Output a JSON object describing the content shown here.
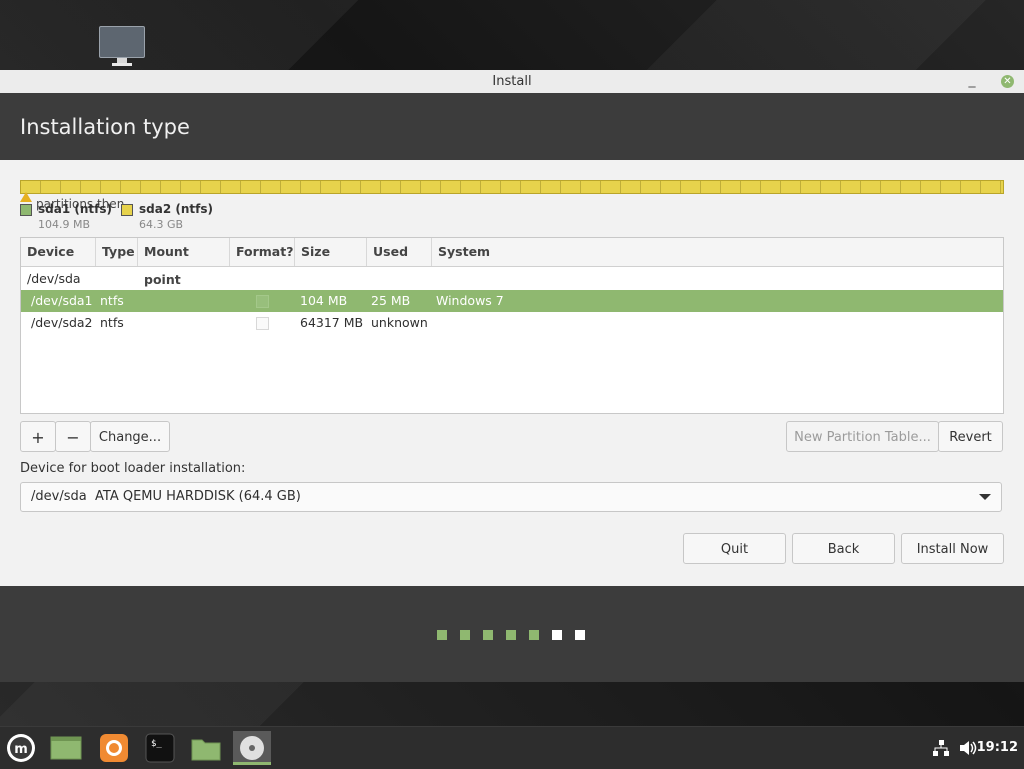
{
  "window": {
    "title": "Install"
  },
  "header": {
    "title": "Installation type"
  },
  "partition_bar": {
    "warning_text": "partitions then",
    "legend": [
      {
        "name": "sda1 (ntfs)",
        "size": "104.9 MB",
        "color": "#8fb870"
      },
      {
        "name": "sda2 (ntfs)",
        "size": "64.3 GB",
        "color": "#e7d34c"
      }
    ]
  },
  "table": {
    "columns": [
      "Device",
      "Type",
      "Mount point",
      "Format?",
      "Size",
      "Used",
      "System"
    ],
    "disk": "/dev/sda",
    "rows": [
      {
        "device": "/dev/sda1",
        "type": "ntfs",
        "mount": "",
        "format": false,
        "size": "104 MB",
        "used": "25 MB",
        "system": "Windows 7",
        "selected": true
      },
      {
        "device": "/dev/sda2",
        "type": "ntfs",
        "mount": "",
        "format": false,
        "size": "64317 MB",
        "used": "unknown",
        "system": "",
        "selected": false
      }
    ]
  },
  "toolbar": {
    "add_label": "+",
    "remove_label": "−",
    "change_label": "Change...",
    "new_table_label": "New Partition Table...",
    "revert_label": "Revert"
  },
  "boot": {
    "label": "Device for boot loader installation:",
    "device": "/dev/sda",
    "model": "ATA QEMU HARDDISK (64.4 GB)"
  },
  "actions": {
    "quit": "Quit",
    "back": "Back",
    "install": "Install Now"
  },
  "progress": {
    "total_steps": 7,
    "completed_steps": 5
  },
  "panel": {
    "clock": "19:12"
  },
  "colors": {
    "accent": "#8fb870",
    "header": "#3c3c3c"
  }
}
